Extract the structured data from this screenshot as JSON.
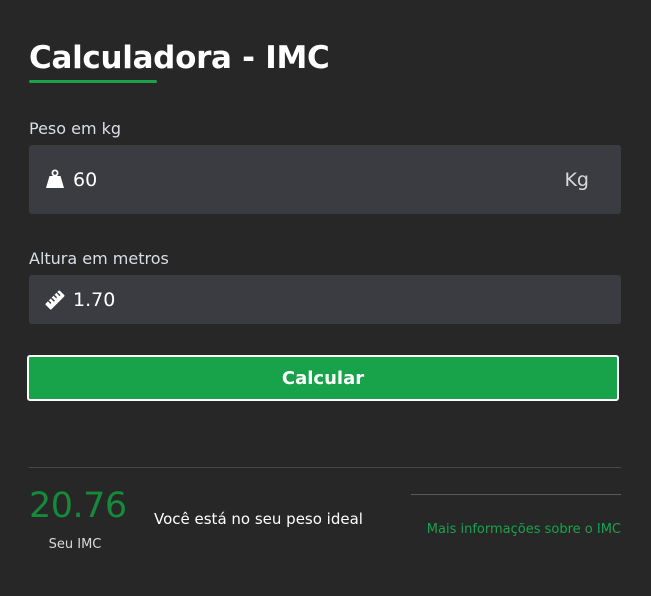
{
  "header": {
    "title": "Calculadora - IMC"
  },
  "form": {
    "peso": {
      "label": "Peso em kg",
      "value": "60",
      "unit": "Kg",
      "icon": "weight-icon"
    },
    "altura": {
      "label": "Altura em metros",
      "value": "1.70",
      "icon": "ruler-icon"
    },
    "submit_label": "Calcular"
  },
  "result": {
    "imc_value": "20.76",
    "imc_label": "Seu IMC",
    "message": "Você está no seu peso ideal",
    "more_info_link": "Mais informações sobre o IMC"
  },
  "colors": {
    "background": "#282828",
    "accent": "#1aa34a",
    "input_bg": "#3b3c41",
    "imc_value": "#148a3a"
  }
}
